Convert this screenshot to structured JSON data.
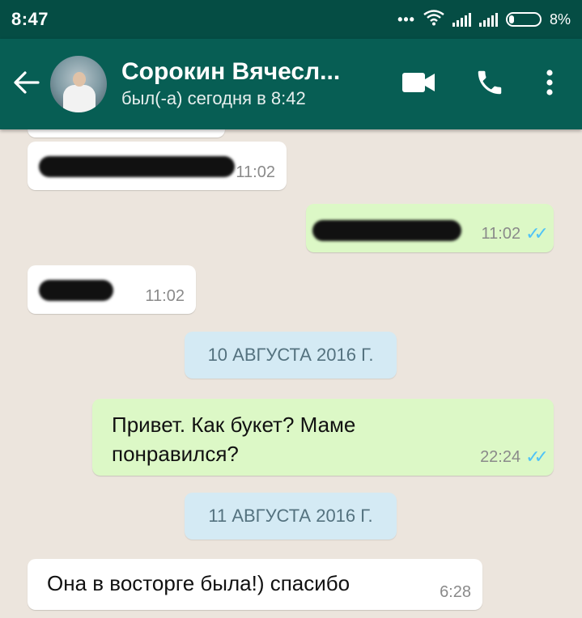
{
  "status_bar": {
    "time": "8:47",
    "battery_percent": "8%"
  },
  "header": {
    "contact_name": "Сорокин Вячесл...",
    "last_seen": "был(-а) сегодня в 8:42",
    "icons": [
      "back-arrow-icon",
      "video-call-icon",
      "phone-icon",
      "more-vert-icon"
    ]
  },
  "messages": [
    {
      "direction": "incoming",
      "text": "",
      "time": "11:02",
      "redacted": true
    },
    {
      "direction": "outgoing",
      "text": "",
      "time": "11:02",
      "read": true,
      "redacted": true
    },
    {
      "direction": "incoming",
      "text": "",
      "time": "11:02",
      "redacted": true
    },
    {
      "type": "date",
      "text": "10 АВГУСТА 2016 Г."
    },
    {
      "direction": "outgoing",
      "text_line1": "Привет. Как букет? Маме",
      "text_line2": "понравился?",
      "time": "22:24",
      "read": true
    },
    {
      "type": "date",
      "text": "11 АВГУСТА 2016 Г."
    },
    {
      "direction": "incoming",
      "text": "Она в восторге была!) спасибо",
      "time": "6:28"
    }
  ],
  "colors": {
    "status_bar": "#054d44",
    "app_bar": "#075e54",
    "chat_background": "#ece5dd",
    "incoming_bubble": "#ffffff",
    "outgoing_bubble": "#dcf8c6",
    "date_chip": "#d4eaf4",
    "read_ticks": "#4fc3f7"
  }
}
